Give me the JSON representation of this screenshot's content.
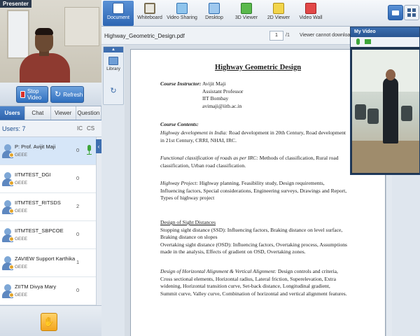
{
  "presenter": {
    "label": "Presenter"
  },
  "controls": {
    "stop_video": "Stop Video",
    "refresh": "Refresh"
  },
  "tabs": [
    {
      "label": "Users",
      "active": true
    },
    {
      "label": "Chat",
      "active": false
    },
    {
      "label": "Viewer",
      "active": false
    },
    {
      "label": "Question",
      "active": false
    }
  ],
  "users": {
    "count_label": "Users: 7",
    "col_ic": "IC",
    "col_cs": "CS",
    "rows": [
      {
        "name": "P: Prof. Avijit Maji",
        "org": "GEEE",
        "ic": "0",
        "selected": true
      },
      {
        "name": "IITMTEST_DGI",
        "org": "GEEE",
        "ic": "0",
        "selected": false
      },
      {
        "name": "IITMTEST_RITSDS",
        "org": "GEEE",
        "ic": "2",
        "selected": false
      },
      {
        "name": "IITMTEST_SBPCOE",
        "org": "GEEE",
        "ic": "0",
        "selected": false
      },
      {
        "name": "ZAVIEW Support Karthika",
        "org": "GEEE",
        "ic": "1",
        "selected": false
      },
      {
        "name": "ZIITM Divya Mary",
        "org": "GEEE",
        "ic": "0",
        "selected": false
      }
    ]
  },
  "toolbar": {
    "items": [
      {
        "label": "Document",
        "icon": "document-icon",
        "active": true
      },
      {
        "label": "Whiteboard",
        "icon": "whiteboard-icon",
        "active": false
      },
      {
        "label": "Video Sharing",
        "icon": "video-sharing-icon",
        "active": false
      },
      {
        "label": "Desktop",
        "icon": "desktop-icon",
        "active": false
      },
      {
        "label": "3D Viewer",
        "icon": "3d-viewer-icon",
        "active": false
      },
      {
        "label": "2D Viewer",
        "icon": "2d-viewer-icon",
        "active": false
      },
      {
        "label": "Video Wall",
        "icon": "video-wall-icon",
        "active": false
      }
    ]
  },
  "document": {
    "filename": "Highway_Geometric_Design.pdf",
    "page_current": "1",
    "page_total": "/1",
    "download_note": "Viewer cannot download the",
    "library_label": "Library",
    "title": "Highway Geometric Design",
    "instructor_label": "Course Instructor:",
    "instructor_name": "Avijit Maji",
    "instructor_role": "Assistant Professor",
    "instructor_inst": "IIT Bombay",
    "instructor_email": "avimaji@iitb.ac.in",
    "contents_label": "Course Contents:",
    "p1_lead": "Highway development in India:",
    "p1_text": " Road development in 20th Century, Road development in 21st Century, CRRI, NHAI, IRC.",
    "p2_lead": "Functional classification of roads as per IRC:",
    "p2_text": " Methods of classification, Rural road classification, Urban road classification.",
    "p3_lead": "Highway Project:",
    "p3_text": " Highway planning, Feasibility study, Design requirements, Influencing factors, Special considerations, Engineering surveys, Drawings and Report, Types of highway project",
    "p4_head": "Design of Sight Distances",
    "p4_l1": "Stopping sight distance (SSD): Influencing factors, Braking distance on level surface, Braking distance on slopes",
    "p4_l2": "Overtaking sight distance (OSD): Influencing factors, Overtaking process, Assumptions made in the analysis, Effects of gradient on OSD, Overtaking zones.",
    "p5_lead": "Design of Horizontal Alignment & Vertical Alignment:",
    "p5_text": " Design controls and criteria, Cross sectional elements, Horizontal radius, Lateral friction, Superelevation, Extra widening, Horizontal transition curve, Set-back distance, Longitudinal gradient, Summit curve, Valley curve, Combination of horizontal and vertical alignment features."
  },
  "my_video": {
    "title": "My Video"
  }
}
